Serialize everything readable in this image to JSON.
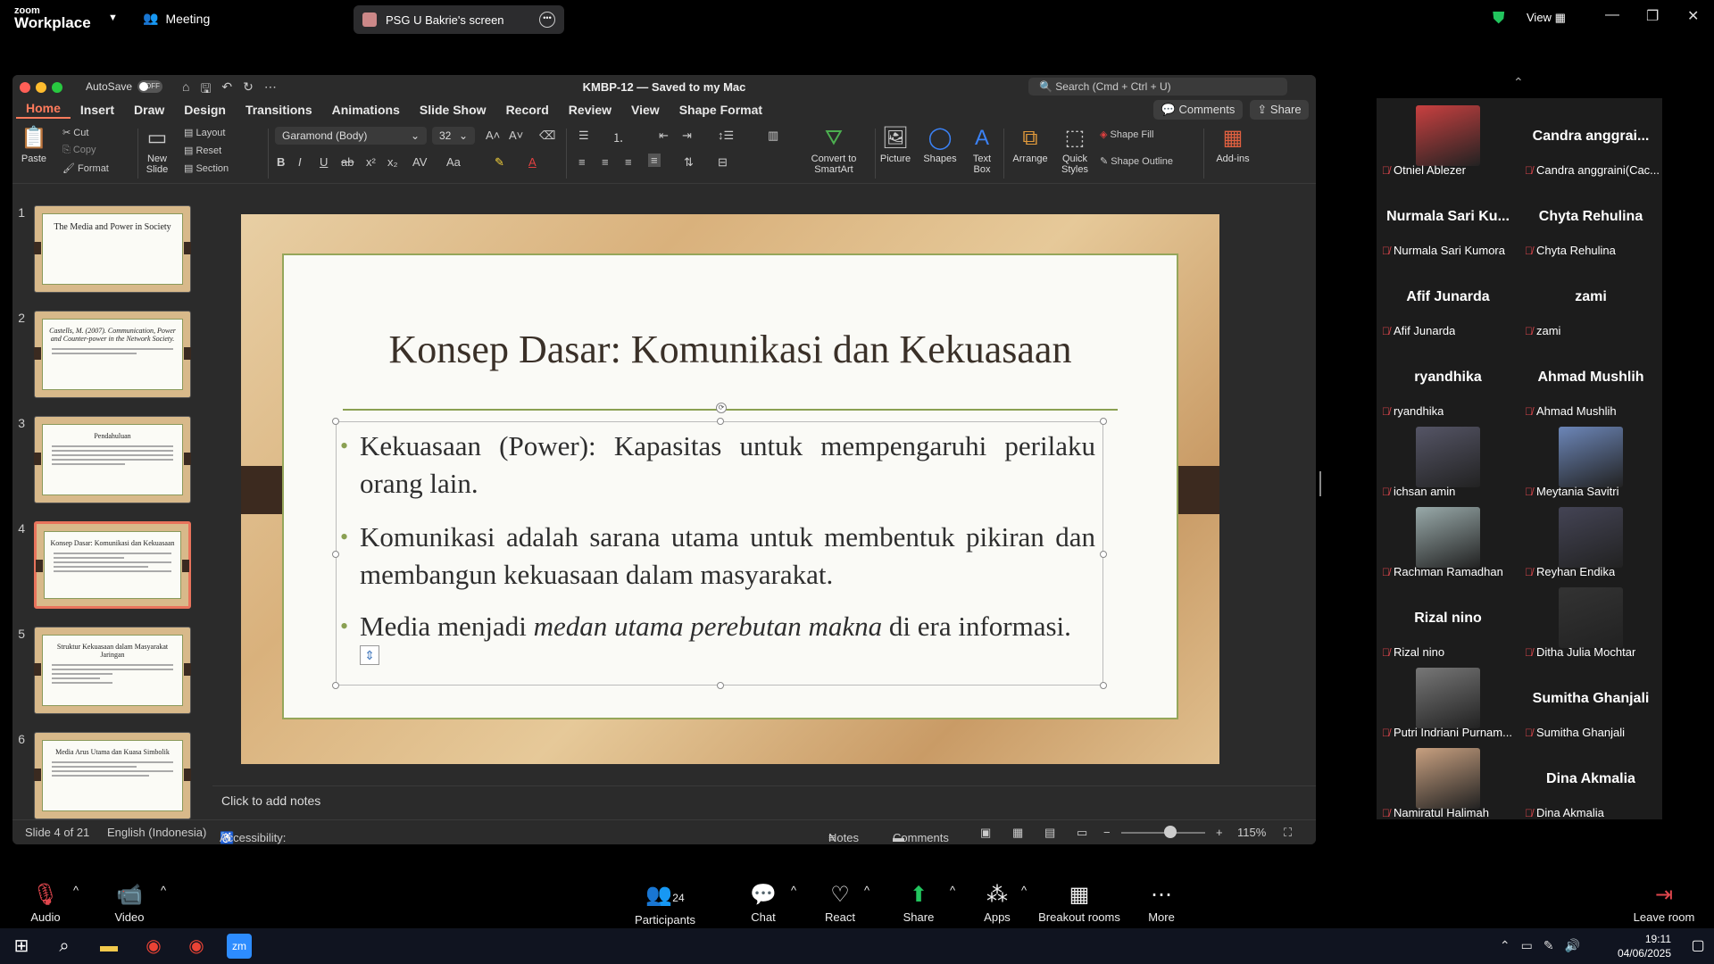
{
  "zoom": {
    "logo_line1": "zoom",
    "logo_line2": "Workplace",
    "meeting_label": "Meeting",
    "share_banner": "PSG U Bakrie's screen",
    "view_label": "View",
    "toolbar": {
      "audio": "Audio",
      "video": "Video",
      "participants": "Participants",
      "participants_count": "24",
      "chat": "Chat",
      "react": "React",
      "share": "Share",
      "apps": "Apps",
      "breakout": "Breakout rooms",
      "more": "More",
      "leave": "Leave room"
    }
  },
  "ppt": {
    "autosave_label": "AutoSave",
    "autosave_state": "OFF",
    "doc_title": "KMBP-12 — Saved to my Mac",
    "search_placeholder": "Search (Cmd + Ctrl + U)",
    "tabs": [
      "Home",
      "Insert",
      "Draw",
      "Design",
      "Transitions",
      "Animations",
      "Slide Show",
      "Record",
      "Review",
      "View",
      "Shape Format"
    ],
    "comments_btn": "Comments",
    "share_btn": "Share",
    "ribbon": {
      "paste": "Paste",
      "cut": "Cut",
      "copy": "Copy",
      "format": "Format",
      "new_slide": "New Slide",
      "layout": "Layout",
      "reset": "Reset",
      "section": "Section",
      "font_name": "Garamond (Body)",
      "font_size": "32",
      "convert_smartart": "Convert to SmartArt",
      "picture": "Picture",
      "shapes": "Shapes",
      "text_box": "Text Box",
      "arrange": "Arrange",
      "quick_styles": "Quick Styles",
      "shape_fill": "Shape Fill",
      "shape_outline": "Shape Outline",
      "add_ins": "Add-ins"
    },
    "thumbnails": [
      {
        "num": "1",
        "title": "The Media and Power in Society"
      },
      {
        "num": "2",
        "title": "Castells, M. (2007). Communication, Power and Counter-power in the Network Society."
      },
      {
        "num": "3",
        "title": "Pendahuluan"
      },
      {
        "num": "4",
        "title": "Konsep Dasar: Komunikasi dan Kekuasaan"
      },
      {
        "num": "5",
        "title": "Struktur Kekuasaan dalam Masyarakat Jaringan"
      },
      {
        "num": "6",
        "title": "Media Arus Utama dan Kuasa Simbolik"
      }
    ],
    "selected_slide": 4,
    "slide": {
      "title": "Konsep Dasar: Komunikasi dan Kekuasaan",
      "bullet1": "Kekuasaan (Power): Kapasitas untuk mempengaruhi perilaku orang lain.",
      "bullet2": "Komunikasi adalah sarana utama untuk membentuk pikiran dan membangun kekuasaan dalam masyarakat.",
      "bullet3_pre": "Media menjadi ",
      "bullet3_em": "medan utama perebutan makna",
      "bullet3_post": " di era informasi."
    },
    "notes_placeholder": "Click to add notes",
    "status": {
      "slide_pos": "Slide 4 of 21",
      "language": "English (Indonesia)",
      "accessibility": "Accessibility: Investigate",
      "notes": "Notes",
      "comments": "Comments",
      "zoom": "115%"
    }
  },
  "participants": [
    {
      "name": "Otniel Ablezer",
      "display": "",
      "photo": true,
      "muted": true
    },
    {
      "name": "Candra anggraini(Cac...",
      "display": "Candra anggrai...",
      "photo": false,
      "muted": true
    },
    {
      "name": "Nurmala Sari Kumora",
      "display": "Nurmala Sari Ku...",
      "photo": false,
      "muted": true
    },
    {
      "name": "Chyta Rehulina",
      "display": "Chyta Rehulina",
      "photo": false,
      "muted": true
    },
    {
      "name": "Afif Junarda",
      "display": "Afif Junarda",
      "photo": false,
      "muted": true
    },
    {
      "name": "zami",
      "display": "zami",
      "photo": false,
      "muted": true
    },
    {
      "name": "ryandhika",
      "display": "ryandhika",
      "photo": false,
      "muted": true
    },
    {
      "name": "Ahmad Mushlih",
      "display": "Ahmad Mushlih",
      "photo": false,
      "muted": true
    },
    {
      "name": "ichsan amin",
      "display": "",
      "photo": true,
      "muted": true
    },
    {
      "name": "Meytania Savitri",
      "display": "",
      "photo": true,
      "muted": true
    },
    {
      "name": "Rachman Ramadhan",
      "display": "",
      "photo": true,
      "muted": true
    },
    {
      "name": "Reyhan Endika",
      "display": "",
      "photo": true,
      "muted": true
    },
    {
      "name": "Rizal nino",
      "display": "Rizal nino",
      "photo": false,
      "muted": true
    },
    {
      "name": "Ditha Julia Mochtar",
      "display": "",
      "photo": true,
      "muted": true
    },
    {
      "name": "Putri Indriani Purnam...",
      "display": "",
      "photo": true,
      "muted": true
    },
    {
      "name": "Sumitha Ghanjali",
      "display": "Sumitha Ghanjali",
      "photo": false,
      "muted": true
    },
    {
      "name": "Namiratul Halimah",
      "display": "",
      "photo": true,
      "muted": true
    },
    {
      "name": "Dina Akmalia",
      "display": "Dina Akmalia",
      "photo": false,
      "muted": true
    }
  ],
  "taskbar": {
    "time": "19:11",
    "date": "04/06/2025"
  },
  "colors": {
    "accent_tab": "#ff7b5c",
    "slide_rule": "#8aa052",
    "muted_mic": "#e0464d",
    "share_green": "#22c55e"
  }
}
